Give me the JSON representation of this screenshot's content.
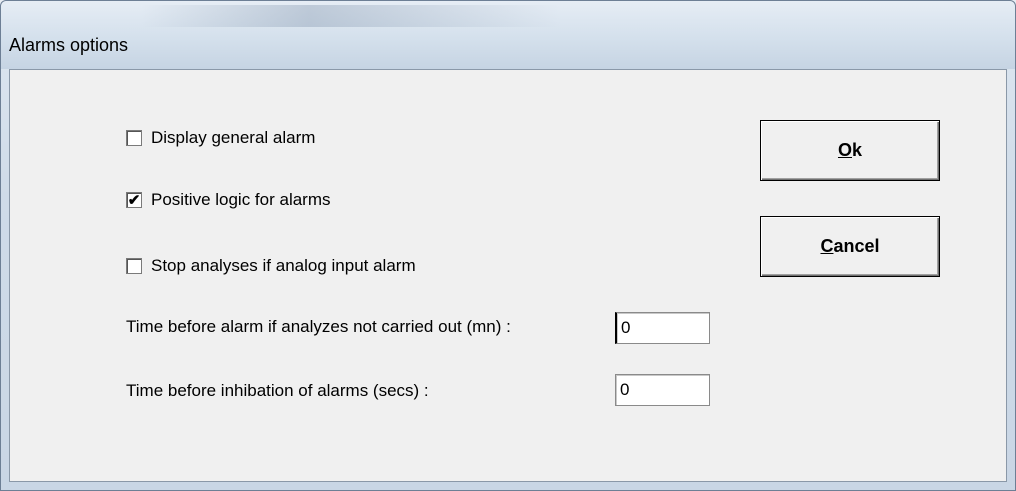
{
  "window": {
    "title": "Alarms options"
  },
  "options": [
    {
      "label": "Display general alarm",
      "checked": false
    },
    {
      "label": "Positive logic for alarms",
      "checked": true
    },
    {
      "label": "Stop analyses if analog input alarm",
      "checked": false
    }
  ],
  "fields": [
    {
      "label": "Time before alarm if analyzes not carried out (mn) :",
      "value": "0"
    },
    {
      "label": "Time before inhibation of alarms (secs) :",
      "value": "0"
    }
  ],
  "buttons": {
    "ok": {
      "accel": "O",
      "rest": "k"
    },
    "cancel": {
      "accel": "C",
      "rest": "ancel"
    }
  },
  "check_mark": "✔"
}
